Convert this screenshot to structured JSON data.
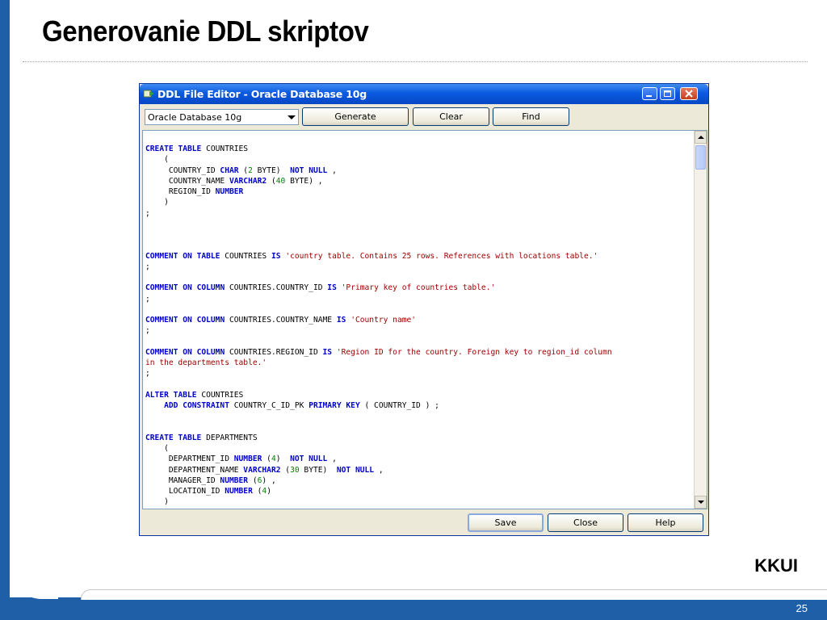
{
  "slide": {
    "title": "Generovanie DDL skriptov",
    "organization": "KKUI",
    "page_number": "25"
  },
  "window": {
    "title": "DDL File Editor - Oracle Database 10g",
    "database_select": {
      "selected": "Oracle Database 10g"
    },
    "buttons": {
      "generate": "Generate",
      "clear": "Clear",
      "find": "Find",
      "save": "Save",
      "close": "Close",
      "help": "Help"
    }
  },
  "editor": {
    "lines": [
      [
        [
          "k",
          "CREATE"
        ],
        [
          "t",
          " "
        ],
        [
          "k",
          "TABLE"
        ],
        [
          "t",
          " COUNTRIES"
        ]
      ],
      [
        [
          "t",
          "    ("
        ]
      ],
      [
        [
          "t",
          "     COUNTRY_ID "
        ],
        [
          "k",
          "CHAR"
        ],
        [
          "t",
          " ("
        ],
        [
          "n",
          "2"
        ],
        [
          "t",
          " BYTE)  "
        ],
        [
          "k",
          "NOT NULL"
        ],
        [
          "t",
          " ,"
        ]
      ],
      [
        [
          "t",
          "     COUNTRY_NAME "
        ],
        [
          "k",
          "VARCHAR2"
        ],
        [
          "t",
          " ("
        ],
        [
          "n",
          "40"
        ],
        [
          "t",
          " BYTE) ,"
        ]
      ],
      [
        [
          "t",
          "     REGION_ID "
        ],
        [
          "k",
          "NUMBER"
        ]
      ],
      [
        [
          "t",
          "    )"
        ]
      ],
      [
        [
          "t",
          ";"
        ]
      ],
      [
        [
          "t",
          ""
        ]
      ],
      [
        [
          "t",
          ""
        ]
      ],
      [
        [
          "t",
          ""
        ]
      ],
      [
        [
          "k",
          "COMMENT"
        ],
        [
          "t",
          " "
        ],
        [
          "k",
          "ON"
        ],
        [
          "t",
          " "
        ],
        [
          "k",
          "TABLE"
        ],
        [
          "t",
          " COUNTRIES "
        ],
        [
          "k",
          "IS"
        ],
        [
          "t",
          " "
        ],
        [
          "s",
          "'country table. Contains 25 rows. References with locations table.'"
        ]
      ],
      [
        [
          "t",
          ";"
        ]
      ],
      [
        [
          "t",
          ""
        ]
      ],
      [
        [
          "k",
          "COMMENT"
        ],
        [
          "t",
          " "
        ],
        [
          "k",
          "ON"
        ],
        [
          "t",
          " "
        ],
        [
          "k",
          "COLUMN"
        ],
        [
          "t",
          " COUNTRIES.COUNTRY_ID "
        ],
        [
          "k",
          "IS"
        ],
        [
          "t",
          " "
        ],
        [
          "s",
          "'Primary key of countries table.'"
        ]
      ],
      [
        [
          "t",
          ";"
        ]
      ],
      [
        [
          "t",
          ""
        ]
      ],
      [
        [
          "k",
          "COMMENT"
        ],
        [
          "t",
          " "
        ],
        [
          "k",
          "ON"
        ],
        [
          "t",
          " "
        ],
        [
          "k",
          "COLUMN"
        ],
        [
          "t",
          " COUNTRIES.COUNTRY_NAME "
        ],
        [
          "k",
          "IS"
        ],
        [
          "t",
          " "
        ],
        [
          "s",
          "'Country name'"
        ]
      ],
      [
        [
          "t",
          ";"
        ]
      ],
      [
        [
          "t",
          ""
        ]
      ],
      [
        [
          "k",
          "COMMENT"
        ],
        [
          "t",
          " "
        ],
        [
          "k",
          "ON"
        ],
        [
          "t",
          " "
        ],
        [
          "k",
          "COLUMN"
        ],
        [
          "t",
          " COUNTRIES.REGION_ID "
        ],
        [
          "k",
          "IS"
        ],
        [
          "t",
          " "
        ],
        [
          "s",
          "'Region ID for the country. Foreign key to region_id column"
        ]
      ],
      [
        [
          "s",
          "in the departments table.'"
        ]
      ],
      [
        [
          "t",
          ";"
        ]
      ],
      [
        [
          "t",
          ""
        ]
      ],
      [
        [
          "k",
          "ALTER"
        ],
        [
          "t",
          " "
        ],
        [
          "k",
          "TABLE"
        ],
        [
          "t",
          " COUNTRIES"
        ]
      ],
      [
        [
          "t",
          "    "
        ],
        [
          "k",
          "ADD"
        ],
        [
          "t",
          " "
        ],
        [
          "k",
          "CONSTRAINT"
        ],
        [
          "t",
          " COUNTRY_C_ID_PK "
        ],
        [
          "k",
          "PRIMARY"
        ],
        [
          "t",
          " "
        ],
        [
          "k",
          "KEY"
        ],
        [
          "t",
          " ( COUNTRY_ID ) ;"
        ]
      ],
      [
        [
          "t",
          ""
        ]
      ],
      [
        [
          "t",
          ""
        ]
      ],
      [
        [
          "k",
          "CREATE"
        ],
        [
          "t",
          " "
        ],
        [
          "k",
          "TABLE"
        ],
        [
          "t",
          " DEPARTMENTS"
        ]
      ],
      [
        [
          "t",
          "    ("
        ]
      ],
      [
        [
          "t",
          "     DEPARTMENT_ID "
        ],
        [
          "k",
          "NUMBER"
        ],
        [
          "t",
          " ("
        ],
        [
          "n",
          "4"
        ],
        [
          "t",
          ")  "
        ],
        [
          "k",
          "NOT NULL"
        ],
        [
          "t",
          " ,"
        ]
      ],
      [
        [
          "t",
          "     DEPARTMENT_NAME "
        ],
        [
          "k",
          "VARCHAR2"
        ],
        [
          "t",
          " ("
        ],
        [
          "n",
          "30"
        ],
        [
          "t",
          " BYTE)  "
        ],
        [
          "k",
          "NOT NULL"
        ],
        [
          "t",
          " ,"
        ]
      ],
      [
        [
          "t",
          "     MANAGER_ID "
        ],
        [
          "k",
          "NUMBER"
        ],
        [
          "t",
          " ("
        ],
        [
          "n",
          "6"
        ],
        [
          "t",
          ") ,"
        ]
      ],
      [
        [
          "t",
          "     LOCATION_ID "
        ],
        [
          "k",
          "NUMBER"
        ],
        [
          "t",
          " ("
        ],
        [
          "n",
          "4"
        ],
        [
          "t",
          ")"
        ]
      ],
      [
        [
          "t",
          "    )"
        ]
      ]
    ]
  },
  "colors": {
    "keyword": "#0000cc",
    "string": "#a00000",
    "number": "#008000",
    "slide_accent": "#1f5fa8",
    "titlebar": "#0a5ae0"
  },
  "icons": [
    "app-icon",
    "minimize-icon",
    "maximize-icon",
    "close-icon",
    "dropdown-arrow-icon",
    "scroll-up-icon",
    "scroll-down-icon"
  ]
}
